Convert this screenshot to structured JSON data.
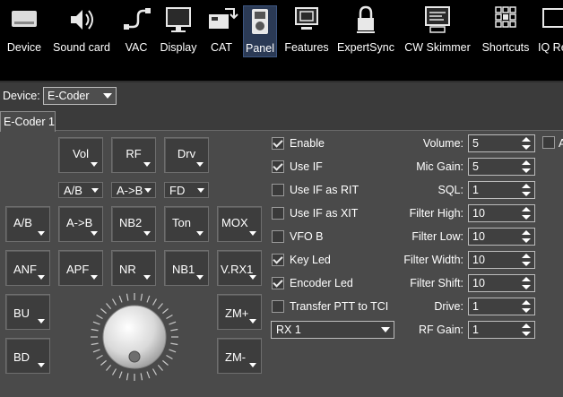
{
  "toolbar": {
    "items": [
      {
        "label": "Device",
        "icon": "device-icon"
      },
      {
        "label": "Sound card",
        "icon": "speaker-icon"
      },
      {
        "label": "VAC",
        "icon": "cable-icon"
      },
      {
        "label": "Display",
        "icon": "monitor-icon"
      },
      {
        "label": "CAT",
        "icon": "cat-icon"
      },
      {
        "label": "Panel",
        "icon": "panel-icon",
        "active": true
      },
      {
        "label": "Features",
        "icon": "features-icon"
      },
      {
        "label": "ExpertSync",
        "icon": "lock-icon"
      },
      {
        "label": "CW Skimmer",
        "icon": "skimmer-icon"
      },
      {
        "label": "Shortcuts",
        "icon": "keyboard-icon"
      },
      {
        "label": "IQ Re",
        "icon": "iq-icon"
      }
    ]
  },
  "device": {
    "label": "Device:",
    "value": "E-Coder"
  },
  "tab": {
    "label": "E-Coder 1"
  },
  "panel": {
    "top_row": [
      "Vol",
      "RF",
      "Drv"
    ],
    "small_row": [
      "A/B",
      "A->B",
      "FD"
    ],
    "row1": [
      "A/B",
      "A->B",
      "NB2",
      "Ton",
      "MOX"
    ],
    "row2": [
      "ANF",
      "APF",
      "NR",
      "NB1",
      "V.RX1"
    ],
    "left_col": [
      "BU",
      "BD"
    ],
    "right_col": [
      "ZM+",
      "ZM-"
    ]
  },
  "options": {
    "checkboxes": [
      {
        "label": "Enable",
        "checked": true
      },
      {
        "label": "Use IF",
        "checked": true
      },
      {
        "label": "Use IF as RIT",
        "checked": false
      },
      {
        "label": "Use IF as XIT",
        "checked": false
      },
      {
        "label": "VFO B",
        "checked": false
      },
      {
        "label": "Key Led",
        "checked": true
      },
      {
        "label": "Encoder Led",
        "checked": true
      },
      {
        "label": "Transfer PTT to TCI",
        "checked": false
      }
    ],
    "rx_select": "RX 1"
  },
  "fields": [
    {
      "label": "Volume:",
      "value": "5"
    },
    {
      "label": "Mic Gain:",
      "value": "5"
    },
    {
      "label": "SQL:",
      "value": "1"
    },
    {
      "label": "Filter High:",
      "value": "10"
    },
    {
      "label": "Filter Low:",
      "value": "10"
    },
    {
      "label": "Filter Width:",
      "value": "10"
    },
    {
      "label": "Filter Shift:",
      "value": "10"
    },
    {
      "label": "Drive:",
      "value": "1"
    },
    {
      "label": "RF Gain:",
      "value": "1"
    }
  ],
  "edge": {
    "label": "A"
  },
  "colors": {
    "active_tab": "#2b3a55",
    "background": "#4a4a4a"
  }
}
